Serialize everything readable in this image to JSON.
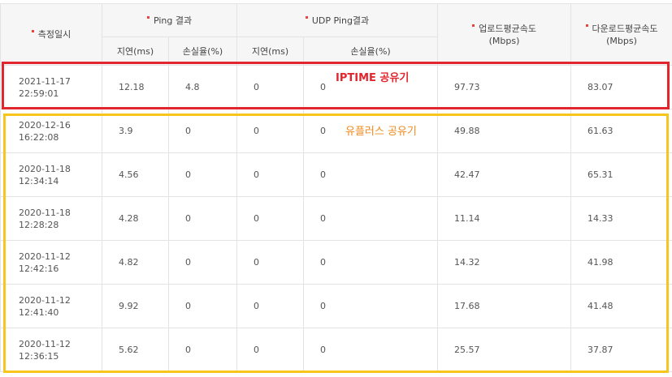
{
  "headers": {
    "measure_time": "측정일시",
    "ping_result": "Ping 결과",
    "udp_ping_result": "UDP Ping결과",
    "upload_avg": [
      "업로드평균속도",
      "(Mbps)"
    ],
    "download_avg": [
      "다운로드평균속도",
      "(Mbps)"
    ],
    "latency": "지연(ms)",
    "loss_rate": "손실율(%)",
    "udp_latency": "지연(ms)",
    "udp_loss_rate": "손실율(%)"
  },
  "rows": [
    {
      "date": "2021-11-17",
      "time": "22:59:01",
      "ping_latency": "12.18",
      "ping_loss": "4.8",
      "udp_latency": "0",
      "udp_loss": "0",
      "upload": "97.73",
      "download": "83.07"
    },
    {
      "date": "2020-12-16",
      "time": "16:22:08",
      "ping_latency": "3.9",
      "ping_loss": "0",
      "udp_latency": "0",
      "udp_loss": "0",
      "upload": "49.88",
      "download": "61.63"
    },
    {
      "date": "2020-11-18",
      "time": "12:34:14",
      "ping_latency": "4.56",
      "ping_loss": "0",
      "udp_latency": "0",
      "udp_loss": "0",
      "upload": "42.47",
      "download": "65.31"
    },
    {
      "date": "2020-11-18",
      "time": "12:28:28",
      "ping_latency": "4.28",
      "ping_loss": "0",
      "udp_latency": "0",
      "udp_loss": "0",
      "upload": "11.14",
      "download": "14.33"
    },
    {
      "date": "2020-11-12",
      "time": "12:42:16",
      "ping_latency": "4.82",
      "ping_loss": "0",
      "udp_latency": "0",
      "udp_loss": "0",
      "upload": "14.32",
      "download": "41.98"
    },
    {
      "date": "2020-11-12",
      "time": "12:41:40",
      "ping_latency": "9.92",
      "ping_loss": "0",
      "udp_latency": "0",
      "udp_loss": "0",
      "upload": "17.68",
      "download": "41.48"
    },
    {
      "date": "2020-11-12",
      "time": "12:36:15",
      "ping_latency": "5.62",
      "ping_loss": "0",
      "udp_latency": "0",
      "udp_loss": "0",
      "upload": "25.57",
      "download": "37.87"
    }
  ],
  "annotations": {
    "iptime_label": "IPTIME 공유기",
    "uplus_label": "유플러스 공유기"
  },
  "colors": {
    "accent_dot": "#e8443a",
    "box_red": "#e1262d",
    "box_yellow": "#f8c51c",
    "label_orange": "#f08a1c"
  }
}
